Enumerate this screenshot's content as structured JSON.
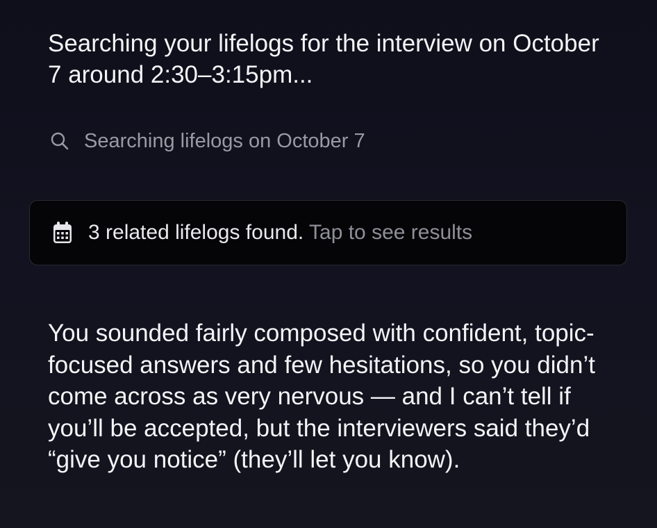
{
  "intro_message": "Searching your lifelogs for the interview on October 7 around 2:30–3:15pm...",
  "search_status": {
    "icon": "search-icon",
    "text": "Searching lifelogs on October 7"
  },
  "results_card": {
    "icon": "calendar-icon",
    "found_text": "3 related lifelogs found.",
    "action_text": "Tap to see results"
  },
  "answer_text": "You sounded fairly composed with confident, topic-focused answers and few hesitations, so you didn’t come across as very nervous — and I can’t tell if you’ll be accepted, but the interviewers said they’d “give you notice” (they’ll let you know).",
  "colors": {
    "background": "#121220",
    "primary_text": "#f4f4f7",
    "muted_text": "#9a9aa4",
    "card_background": "#050507"
  }
}
